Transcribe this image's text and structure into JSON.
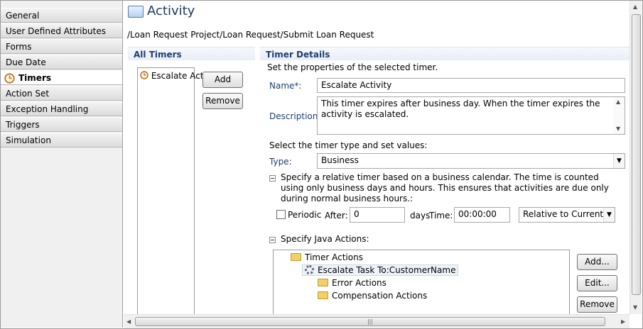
{
  "tabs": [
    {
      "label": "General"
    },
    {
      "label": "User Defined Attributes"
    },
    {
      "label": "Forms"
    },
    {
      "label": "Due Date"
    },
    {
      "label": "Timers",
      "active": true
    },
    {
      "label": "Action Set"
    },
    {
      "label": "Exception Handling"
    },
    {
      "label": "Triggers"
    },
    {
      "label": "Simulation"
    }
  ],
  "header": {
    "title": "Activity",
    "breadcrumb": "/Loan Request Project/Loan Request/Submit Loan Request"
  },
  "all_timers": {
    "title": "All Timers",
    "items": [
      "Escalate Activity"
    ],
    "add_label": "Add",
    "remove_label": "Remove"
  },
  "timer_details": {
    "title": "Timer Details",
    "intro": "Set the properties of the selected timer.",
    "name_label": "Name*:",
    "name_value": "Escalate Activity",
    "description_label": "Description:",
    "description_value": "This timer expires after business day. When the timer expires the activity is escalated.",
    "select_type_text": "Select the timer type and set values:",
    "type_label": "Type:",
    "type_value": "Business",
    "relative_text": "Specify a relative timer based on a business calendar. The time is counted using only business days and hours. This ensures that activities are due only during normal business hours.:",
    "periodic_label": "Periodic",
    "periodic_checked": false,
    "after_label": "After:",
    "after_value": "0",
    "days_label": "days",
    "time_label": "Time:",
    "time_value": "00:00:00",
    "relative_option": "Relative to Current Ti",
    "java_actions_label": "Specify Java Actions:",
    "tree": {
      "root": "Timer Actions",
      "action": "Escalate Task To:CustomerName",
      "error": "Error Actions",
      "compensation": "Compensation Actions"
    },
    "tree_add": "Add...",
    "tree_edit": "Edit...",
    "tree_remove": "Remove"
  }
}
